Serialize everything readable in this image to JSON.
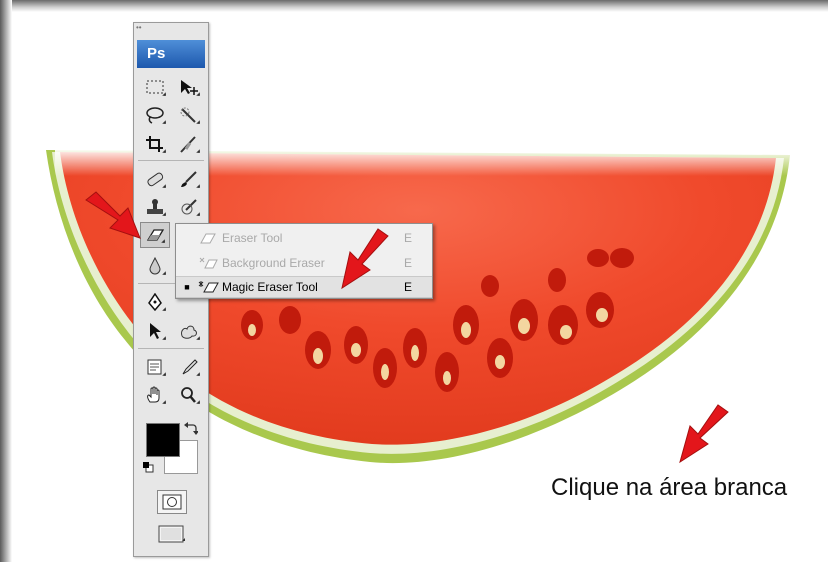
{
  "toolbox": {
    "logo": "Ps",
    "grip": "••"
  },
  "flyout": {
    "items": [
      {
        "label": "Eraser Tool",
        "shortcut": "E",
        "selected": false
      },
      {
        "label": "Background Eraser",
        "shortcut": "E",
        "selected": false
      },
      {
        "label": "Magic Eraser Tool",
        "shortcut": "E",
        "selected": true
      }
    ]
  },
  "caption": "Clique na área branca",
  "colors": {
    "arrow": "#e3161b",
    "watermelon_flesh": "#f04a2c",
    "rind": "#a8c94a",
    "logo_blue": "#1d58ad"
  },
  "icons": {
    "row1": [
      "rectangular-marquee-icon",
      "move-icon"
    ],
    "row2": [
      "lasso-icon",
      "quick-selection-icon"
    ],
    "row3": [
      "crop-icon",
      "slice-icon"
    ],
    "row4": [
      "spot-healing-icon",
      "brush-icon"
    ],
    "row5": [
      "clone-stamp-icon",
      "history-brush-icon"
    ],
    "row6": [
      "eraser-icon",
      "gradient-icon"
    ],
    "row7": [
      "blur-icon",
      "dodge-icon"
    ],
    "row8": [
      "pen-icon",
      "type-icon"
    ],
    "row9": [
      "path-selection-icon",
      "custom-shape-icon"
    ],
    "row10": [
      "notes-icon",
      "eyedropper-icon"
    ],
    "row11": [
      "hand-icon",
      "zoom-icon"
    ]
  }
}
